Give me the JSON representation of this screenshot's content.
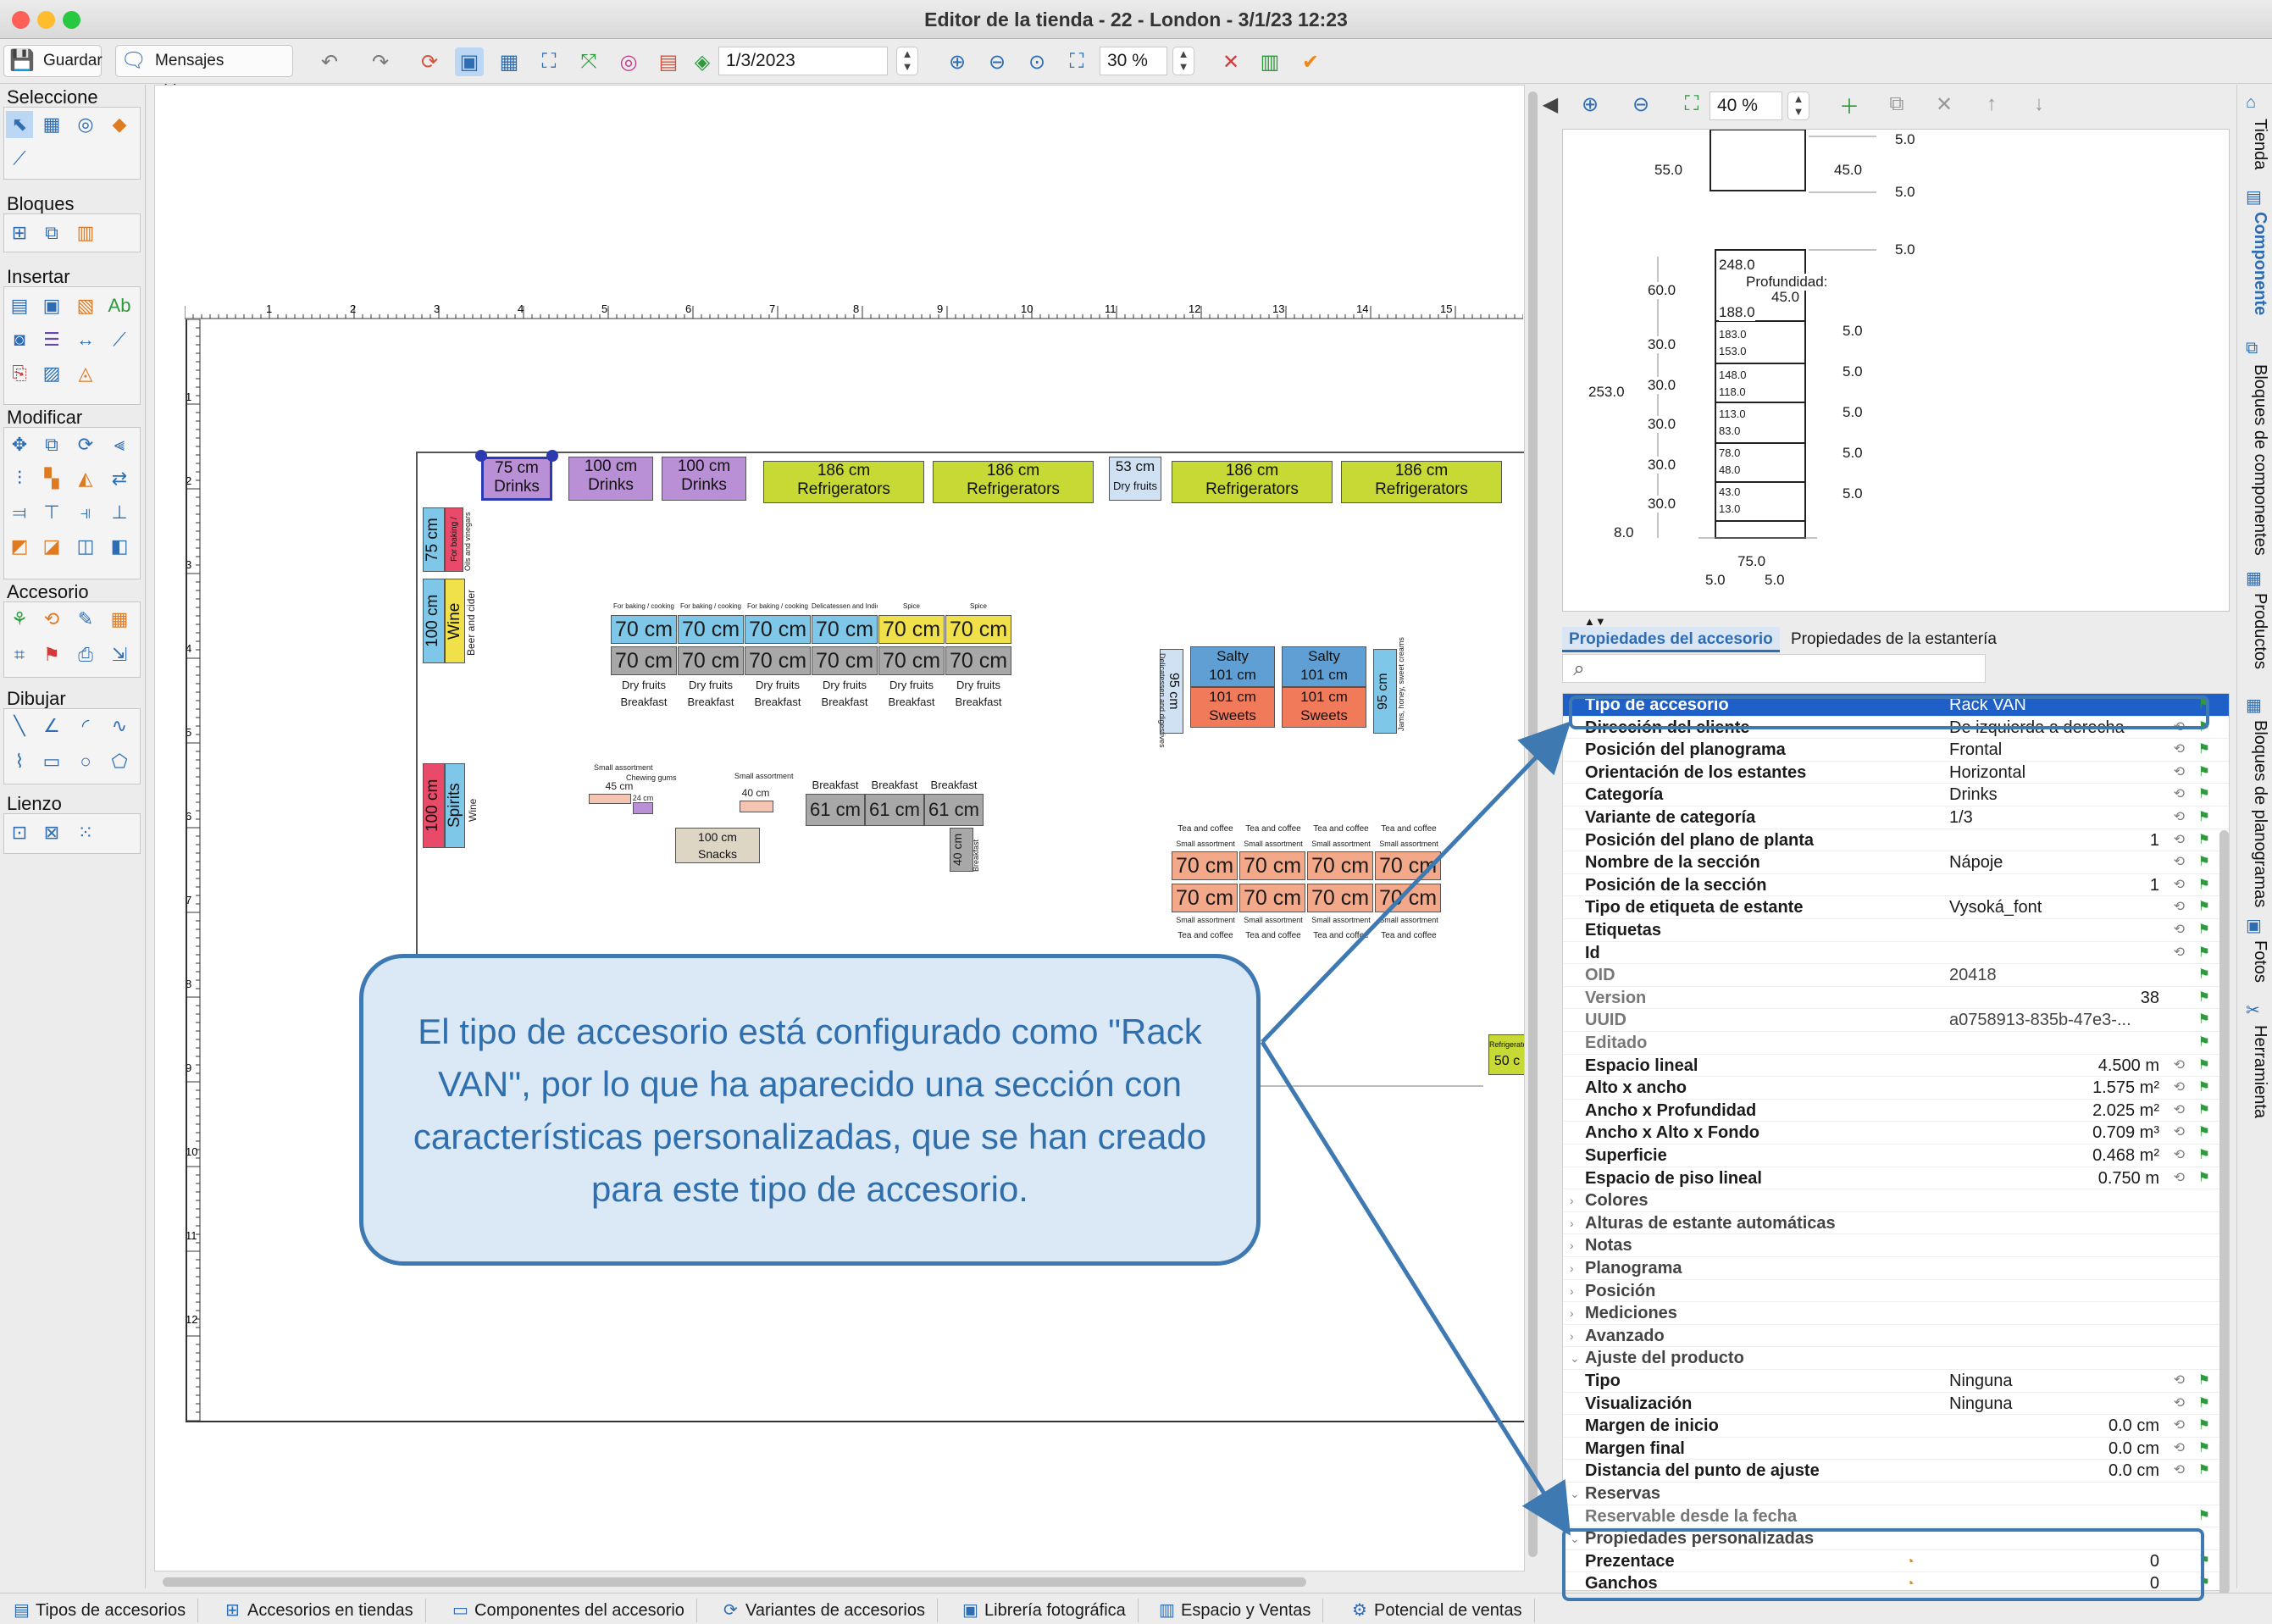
{
  "window": {
    "title": "Editor de la tienda - 22 - London - 3/1/23 12:23"
  },
  "toolbar": {
    "save_label": "Guardar",
    "messages_label": "Mensajes abiertos",
    "date_value": "1/3/2023",
    "zoom_value": "30 %"
  },
  "palette": {
    "groups": [
      "Seleccione",
      "Bloques",
      "Insertar",
      "Modificar",
      "Accesorio",
      "Dibujar",
      "Lienzo"
    ]
  },
  "canvas": {
    "ruler_h": [
      "1",
      "2",
      "3",
      "4",
      "5",
      "6",
      "7",
      "8",
      "9",
      "10",
      "11",
      "12",
      "13",
      "14",
      "15",
      "1"
    ],
    "ruler_v": [
      "1",
      "2",
      "3",
      "4",
      "5",
      "6",
      "7",
      "8",
      "9",
      "10",
      "11",
      "12"
    ],
    "fixtures": [
      {
        "l1": "75 cm",
        "l2": "Drinks"
      },
      {
        "l1": "100 cm",
        "l2": "Drinks"
      },
      {
        "l1": "100 cm",
        "l2": "Drinks"
      },
      {
        "l1": "186 cm",
        "l2": "Refrigerators"
      },
      {
        "l1": "186 cm",
        "l2": "Refrigerators"
      },
      {
        "l1": "53 cm",
        "l2": "Dry fruits"
      },
      {
        "l1": "186 cm",
        "l2": "Refrigerators"
      },
      {
        "l1": "186 cm",
        "l2": "Refrigerators"
      }
    ],
    "v_fixtures": {
      "a1": "75 cm",
      "a2": "For baking / cooking",
      "a3": "Oils and vinegars",
      "b1": "100 cm",
      "b2": "Wine",
      "b3": "Beer and cider",
      "c1": "100 cm",
      "c2": "Spirits",
      "c3": "Wine"
    },
    "mid_top": [
      "For baking / cooking",
      "For baking / cooking",
      "For baking / cooking",
      "Delicatessen and Indicacion",
      "Spice",
      "Spice"
    ],
    "mid_label": "70 cm",
    "mid_bottom1": "Dry fruits",
    "mid_bottom2": "Breakfast",
    "salty": {
      "a": "Salty",
      "b": "101 cm",
      "c": "101 cm",
      "d": "Sweets",
      "e": "95 cm",
      "f": "Delicatessen and digestives",
      "g": "Jams, honey, sweet creams"
    },
    "small": {
      "s1": "Small assortment",
      "s2": "45 cm",
      "s3": "Chewing gums",
      "s4": "24 cm",
      "s5": "Small assortment",
      "s6": "40 cm",
      "snack1": "100 cm",
      "snack2": "Snacks"
    },
    "breakfast": {
      "b": "Breakfast",
      "l": "61 cm",
      "v": "40 cm"
    },
    "tea": {
      "t": "Tea and coffee",
      "s": "Small assortment",
      "l": "70 cm"
    },
    "refr_small": {
      "a": "Refrigerators",
      "b": "50 c"
    }
  },
  "callout": {
    "text": "El tipo de accesorio está configurado como \"Rack VAN\", por lo que ha aparecido una sección con características personalizadas, que se han creado para este tipo de accesorio."
  },
  "preview": {
    "zoom": "40 %",
    "dims": {
      "d55": "55.0",
      "d45a": "45.0",
      "d5a": "5.0",
      "d5b": "5.0",
      "d5c": "5.0",
      "d248": "248.0",
      "prof": "Profundidad:",
      "d45b": "45.0",
      "d188": "188.0",
      "d60": "60.0",
      "d253": "253.0",
      "d30a": "30.0",
      "d30b": "30.0",
      "d30c": "30.0",
      "d30d": "30.0",
      "d30e": "30.0",
      "d8": "8.0",
      "d75": "75.0",
      "d5d": "5.0",
      "d5e": "5.0",
      "s1": "183.0",
      "s1b": "153.0",
      "s2": "148.0",
      "s2b": "118.0",
      "s3": "113.0",
      "s3b": "83.0",
      "s4": "78.0",
      "s4b": "48.0",
      "s5": "43.0",
      "s5b": "13.0",
      "r5": "5.0"
    }
  },
  "tabs": {
    "accessory": "Propiedades del accesorio",
    "shelf": "Propiedades de la estantería"
  },
  "properties": [
    {
      "k": "Tipo de accesorio",
      "v": "Rack VAN",
      "sel": true
    },
    {
      "k": "Dirección del cliente",
      "v": "De izquierda a derecha"
    },
    {
      "k": "Posición del planograma",
      "v": "Frontal"
    },
    {
      "k": "Orientación de los estantes",
      "v": "Horizontal"
    },
    {
      "k": "Categoría",
      "v": "Drinks"
    },
    {
      "k": "Variante de categoría",
      "v": "1/3"
    },
    {
      "k": "Posición del plano de planta",
      "r": "1"
    },
    {
      "k": "Nombre de la sección",
      "v": "Nápoje"
    },
    {
      "k": "Posición de la sección",
      "r": "1"
    },
    {
      "k": "Tipo de etiqueta de estante",
      "v": "Vysoká_font"
    },
    {
      "k": "Etiquetas",
      "v": ""
    },
    {
      "k": "Id",
      "v": ""
    },
    {
      "k": "OID",
      "v": "20418",
      "g": true
    },
    {
      "k": "Version",
      "r": "38",
      "g": true
    },
    {
      "k": "UUID",
      "v": "a0758913-835b-47e3-...",
      "g": true
    },
    {
      "k": "Editado",
      "v": "",
      "g": true
    },
    {
      "k": "Espacio lineal",
      "r": "4.500 m"
    },
    {
      "k": "Alto x ancho",
      "r": "1.575 m²"
    },
    {
      "k": "Ancho x Profundidad",
      "r": "2.025 m²"
    },
    {
      "k": "Ancho x Alto x Fondo",
      "r": "0.709 m³"
    },
    {
      "k": "Superficie",
      "r": "0.468 m²"
    },
    {
      "k": "Espacio de piso lineal",
      "r": "0.750 m"
    },
    {
      "k": "Colores",
      "s": true
    },
    {
      "k": "Alturas de estante automáticas",
      "s": true
    },
    {
      "k": "Notas",
      "s": true
    },
    {
      "k": "Planograma",
      "s": true
    },
    {
      "k": "Posición",
      "s": true
    },
    {
      "k": "Mediciones",
      "s": true
    },
    {
      "k": "Avanzado",
      "s": true
    },
    {
      "k": "Ajuste del producto",
      "s": true,
      "open": true
    },
    {
      "k": "Tipo",
      "v": "Ninguna"
    },
    {
      "k": "Visualización",
      "v": "Ninguna"
    },
    {
      "k": "Margen de inicio",
      "r": "0.0 cm"
    },
    {
      "k": "Margen final",
      "r": "0.0 cm"
    },
    {
      "k": "Distancia del punto de ajuste",
      "r": "0.0 cm"
    },
    {
      "k": "Reservas",
      "s": true,
      "open": true
    },
    {
      "k": "Reservable desde la fecha",
      "v": "",
      "g": true
    },
    {
      "k": "Propiedades personalizadas",
      "s": true,
      "open": true
    },
    {
      "k": "Prezentace",
      "r": "0"
    },
    {
      "k": "Ganchos",
      "r": "0"
    }
  ],
  "vtabs": [
    "Tienda",
    "Componente",
    "Bloques de componentes",
    "Productos",
    "Bloques de planogramas",
    "Fotos",
    "Herramienta"
  ],
  "bottom_tabs": [
    "Tipos de accesorios",
    "Accesorios en tiendas",
    "Componentes del accesorio",
    "Variantes de accesorios",
    "Librería fotográfica",
    "Espacio y Ventas",
    "Potencial de ventas"
  ],
  "colors": {
    "accent": "#3f79b2",
    "purple": "#b98fd6",
    "green": "#c7d934",
    "blue": "#5f9fd3",
    "cyan": "#7fc7e8",
    "yellow": "#f0e04a",
    "salmon": "#f07a5a",
    "pink": "#e94a6a"
  }
}
